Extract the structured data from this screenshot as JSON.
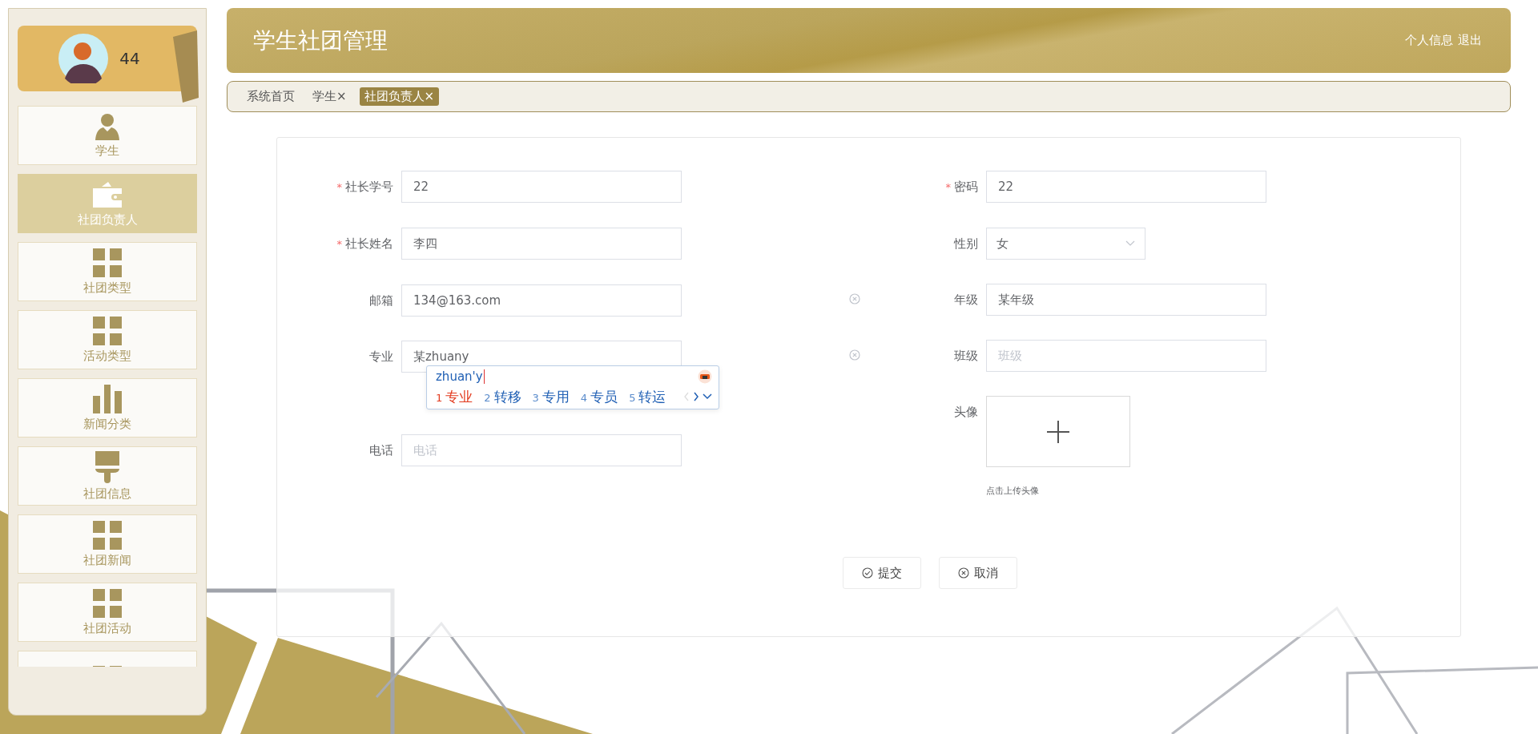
{
  "sidebar": {
    "user": {
      "name": "44"
    },
    "items": [
      {
        "label": "学生",
        "kind": "person",
        "selected": false
      },
      {
        "label": "社团负责人",
        "kind": "wallet",
        "selected": true
      },
      {
        "label": "社团类型",
        "kind": "grid",
        "selected": false
      },
      {
        "label": "活动类型",
        "kind": "grid",
        "selected": false
      },
      {
        "label": "新闻分类",
        "kind": "bars",
        "selected": false
      },
      {
        "label": "社团信息",
        "kind": "brush",
        "selected": false
      },
      {
        "label": "社团新闻",
        "kind": "grid",
        "selected": false
      },
      {
        "label": "社团活动",
        "kind": "grid",
        "selected": false
      },
      {
        "kind": "grid",
        "selected": false
      }
    ]
  },
  "header": {
    "title": "学生社团管理",
    "links": [
      "个人信息",
      "退出"
    ]
  },
  "breadcrumb": [
    {
      "label": "系统首页",
      "selected": false
    },
    {
      "label": "学生",
      "close": "×",
      "selected": false
    },
    {
      "label": "社团负责人",
      "close": "×",
      "selected": true
    }
  ],
  "form": {
    "left": [
      {
        "kind": "input",
        "label": "社长学号",
        "required_mark": "*",
        "value": "22"
      },
      {
        "kind": "input",
        "label": "社长姓名",
        "required_mark": "*",
        "value": "李四"
      },
      {
        "kind": "input",
        "label": "邮箱",
        "value": "134@163.com",
        "clearable": true
      },
      {
        "kind": "input",
        "label": "专业",
        "value": "某zhuany",
        "clearable": true,
        "ime": {
          "composition": "zhuan'y",
          "candidates": [
            {
              "index": "1",
              "text": "专业",
              "selected": true
            },
            {
              "index": "2",
              "text": "转移",
              "selected": false
            },
            {
              "index": "3",
              "text": "专用",
              "selected": false
            },
            {
              "index": "4",
              "text": "专员",
              "selected": false
            },
            {
              "index": "5",
              "text": "转运",
              "selected": false
            }
          ]
        }
      },
      {
        "kind": "input",
        "label": "电话",
        "placeholder": "电话"
      }
    ],
    "right": [
      {
        "kind": "input",
        "label": "密码",
        "required_mark": "*",
        "value": "22"
      },
      {
        "kind": "select",
        "label": "性别",
        "value": "女"
      },
      {
        "kind": "input",
        "label": "年级",
        "value": "某年级"
      },
      {
        "kind": "input",
        "label": "班级",
        "placeholder": "班级"
      },
      {
        "kind": "upload",
        "label": "头像",
        "hint": "点击上传头像"
      }
    ],
    "buttons": [
      {
        "kind": "submit",
        "label": "提交"
      },
      {
        "kind": "cancel",
        "label": "取消"
      }
    ]
  }
}
